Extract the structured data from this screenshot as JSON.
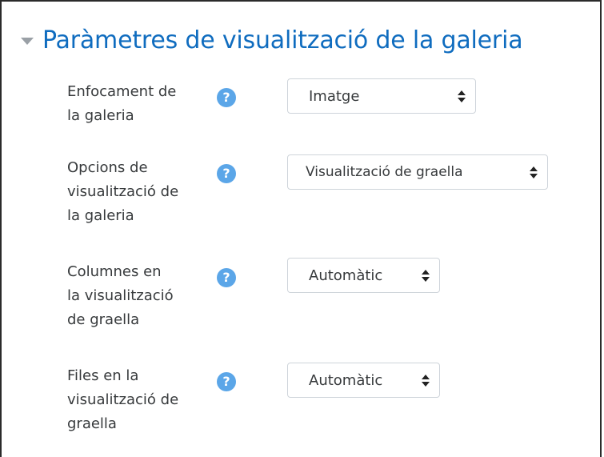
{
  "section": {
    "title": "Paràmetres de visualització de la galeria",
    "collapse_icon": "caret-down-icon"
  },
  "colors": {
    "accent": "#0f6cbf",
    "help_icon": "#5ba6e8",
    "label_text": "#373a3c",
    "select_border": "#ced4da"
  },
  "fields": [
    {
      "label_lines": [
        "Enfocament de",
        "la galeria"
      ],
      "help_icon": "question-circle-icon",
      "help_glyph": "?",
      "value": "Imatge"
    },
    {
      "label_lines": [
        "Opcions de",
        "visualització de",
        "la galeria"
      ],
      "help_icon": "question-circle-icon",
      "help_glyph": "?",
      "value": "Visualització de graella"
    },
    {
      "label_lines": [
        "Columnes en",
        "la visualització",
        "de graella"
      ],
      "help_icon": "question-circle-icon",
      "help_glyph": "?",
      "value": "Automàtic"
    },
    {
      "label_lines": [
        "Files en la",
        "visualització de",
        "graella"
      ],
      "help_icon": "question-circle-icon",
      "help_glyph": "?",
      "value": "Automàtic"
    }
  ]
}
